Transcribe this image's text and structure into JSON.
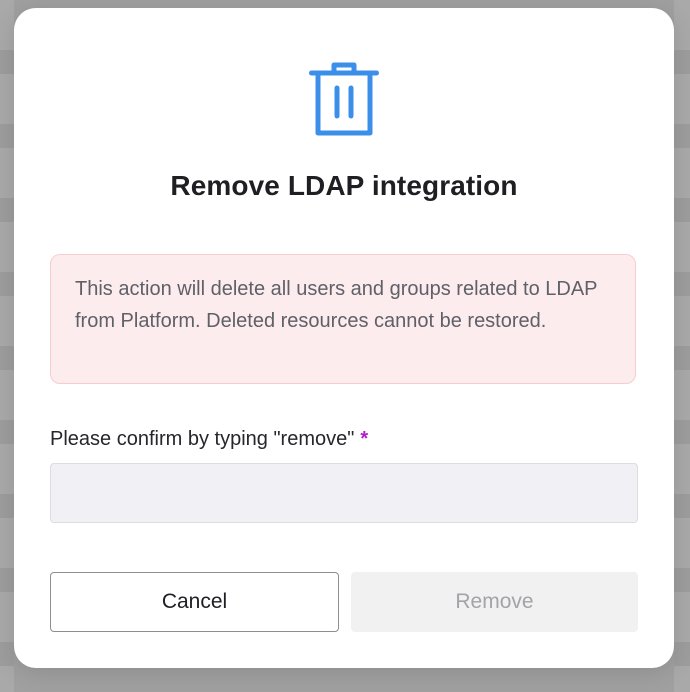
{
  "dialog": {
    "title": "Remove LDAP integration",
    "icon": "trash-icon",
    "warning_text": "This action will delete all users and groups related to LDAP from Platform. Deleted resources cannot be restored.",
    "confirm_label": "Please confirm by typing \"remove\"",
    "required_marker": "*",
    "confirm_input": {
      "value": "",
      "placeholder": ""
    },
    "cancel_label": "Cancel",
    "remove_label": "Remove"
  },
  "colors": {
    "icon_blue": "#3b8fe8",
    "warning_bg": "#fdeced",
    "required": "#b01dc9",
    "disabled_text": "#a3a3a8"
  }
}
